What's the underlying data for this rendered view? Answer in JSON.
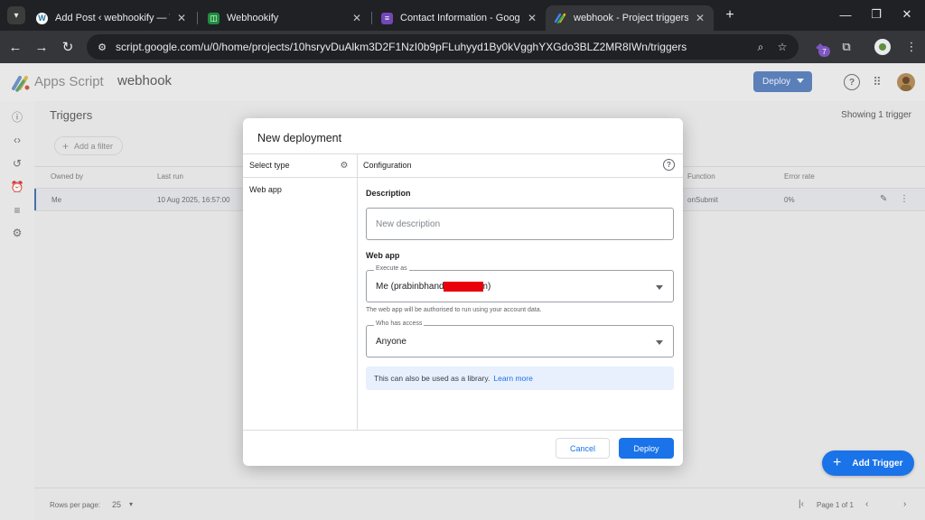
{
  "browser": {
    "tabs": [
      {
        "title": "Add Post ‹ webhookify — WordPress"
      },
      {
        "title": "Webhookify"
      },
      {
        "title": "Contact Information - Google Forms"
      },
      {
        "title": "webhook - Project triggers - Apps Script"
      }
    ],
    "url": "script.google.com/u/0/home/projects/10hsryvDuAlkm3D2F1NzI0b9pFLuhyyd1By0kVgghYXGdo3BLZ2MR8IWn/triggers",
    "extension_badge": "7"
  },
  "app": {
    "name": "Apps Script",
    "project": "webhook",
    "deploy_label": "Deploy"
  },
  "triggers": {
    "title": "Triggers",
    "showing": "Showing 1 trigger",
    "add_filter": "Add a filter",
    "columns": {
      "owned_by": "Owned by",
      "last_run": "Last run",
      "function": "Function",
      "error_rate": "Error rate"
    },
    "row": {
      "owned_by": "Me",
      "last_run": "10 Aug 2025, 16:57:00",
      "function": "onSubmit",
      "error_rate": "0%"
    },
    "rows_per_page_label": "Rows per page:",
    "rows_per_page": "25",
    "page_of": "Page 1 of 1",
    "add_trigger": "Add Trigger"
  },
  "dialog": {
    "title": "New deployment",
    "select_type": "Select type",
    "type_item": "Web app",
    "configuration": "Configuration",
    "description_heading": "Description",
    "description_placeholder": "New description",
    "webapp_heading": "Web app",
    "execute_as_label": "Execute as",
    "execute_as_value": "Me (prabinbhand          gmail.com)",
    "execute_hint": "The web app will be authorised to run using your account data.",
    "access_label": "Who has access",
    "access_value": "Anyone",
    "library_note": "This can also be used as a library.",
    "learn_more": "Learn more",
    "cancel": "Cancel",
    "deploy": "Deploy"
  },
  "colors": {
    "accent": "#1a73e8",
    "redaction": "#e8000b"
  }
}
